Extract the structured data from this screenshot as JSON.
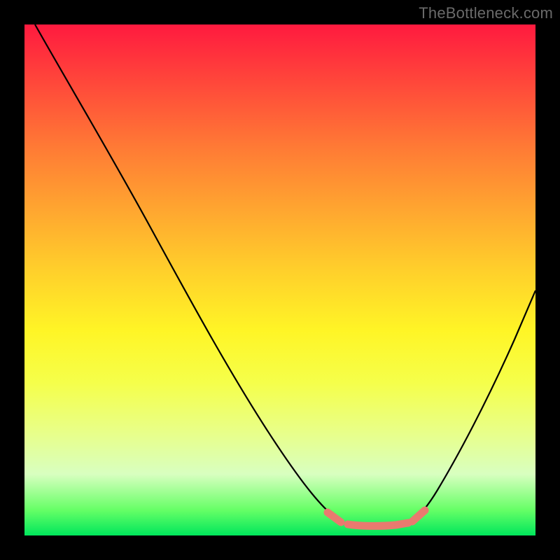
{
  "watermark": "TheBottleneck.com",
  "colors": {
    "frame": "#000000",
    "curve": "#000000",
    "highlight": "#e97a6f",
    "gradient_top": "#ff1a3f",
    "gradient_bottom": "#00e65c"
  },
  "chart_data": {
    "type": "line",
    "title": "",
    "xlabel": "",
    "ylabel": "",
    "xlim": [
      0,
      100
    ],
    "ylim": [
      0,
      100
    ],
    "grid": false,
    "legend": false,
    "series": [
      {
        "name": "left-branch",
        "x": [
          2,
          6,
          12,
          18,
          24,
          30,
          36,
          42,
          47,
          52,
          56,
          59,
          61,
          62.5
        ],
        "values": [
          100,
          92,
          82,
          72,
          62,
          52,
          42,
          32,
          23,
          15,
          9,
          5,
          3,
          2.5
        ]
      },
      {
        "name": "valley-floor",
        "x": [
          62.5,
          64,
          66,
          68,
          70,
          72,
          74,
          75.5
        ],
        "values": [
          2.5,
          2.4,
          2.3,
          2.3,
          2.3,
          2.4,
          2.6,
          2.8
        ]
      },
      {
        "name": "right-branch",
        "x": [
          75.5,
          78,
          81,
          85,
          89,
          93,
          97,
          100
        ],
        "values": [
          2.8,
          5,
          9,
          16,
          25,
          35,
          45,
          55
        ]
      }
    ],
    "annotations": [
      {
        "name": "highlight-left-stub",
        "x_range": [
          59,
          62.5
        ],
        "style": "thick-coral"
      },
      {
        "name": "highlight-floor",
        "x_range": [
          63,
          75
        ],
        "style": "thick-coral"
      },
      {
        "name": "highlight-right-stub",
        "x_range": [
          75.5,
          78
        ],
        "style": "thick-coral"
      }
    ]
  }
}
